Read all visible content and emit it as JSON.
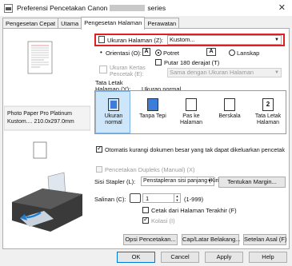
{
  "window": {
    "title_left": "Preferensi Pencetakan Canon",
    "title_right": "series",
    "close": "✕"
  },
  "tabs": [
    {
      "label": "Pengesetan Cepat"
    },
    {
      "label": "Utama"
    },
    {
      "label": "Pengesetan Halaman"
    },
    {
      "label": "Perawatan"
    }
  ],
  "preview": {
    "media_line1": "Photo Paper Pro Platinum",
    "media_line2": "Kustom.... 210.0x297.0mm"
  },
  "page_size": {
    "label": "Ukuran Halaman (Z):",
    "value": "Kustom..."
  },
  "orientation": {
    "label": "Orientasi (O):",
    "portrait": "Potret",
    "landscape": "Lanskap",
    "rotate180": "Putar 180 derajat (T)",
    "portrait_icon": "A",
    "landscape_icon": "A"
  },
  "paper_size": {
    "label_line1": "Ukuran Kertas",
    "label_line2": "Pencetak (E):",
    "value": "Sama dengan Ukuran Halaman"
  },
  "layout": {
    "label_line1": "Tata Letak",
    "label_line2": "Halaman (Y):",
    "current": "Ukuran normal",
    "items": [
      {
        "line1": "Ukuran normal",
        "line2": ""
      },
      {
        "line1": "Tanpa Tepi",
        "line2": ""
      },
      {
        "line1": "Pas ke",
        "line2": "Halaman"
      },
      {
        "line1": "Berskala",
        "line2": ""
      },
      {
        "line1": "Tata Letak",
        "line2": "Halaman"
      }
    ],
    "layout_num": "2"
  },
  "auto_reduce": {
    "label": "Otomatis kurangi dokumen besar yang tak dapat dikeluarkan pencetak"
  },
  "duplex": {
    "label": "Pencetakan Dupleks (Manual) (X)"
  },
  "stapling": {
    "label": "Sisi Stapler (L):",
    "value": "Penstapleran sisi panjang (Kiri)",
    "margin_button": "Tentukan Margin..."
  },
  "copies": {
    "label": "Salinan (C):",
    "value": "1",
    "range": "(1-999)",
    "last_page_first": "Cetak dari Halaman Terakhir (F)",
    "collate": "Kolasi (I)"
  },
  "panel_buttons": {
    "options": "Opsi Pencetakan...",
    "stamp": "Cap/Latar Belakang...",
    "defaults": "Setelan Asal (F)"
  },
  "dialog_buttons": {
    "ok": "OK",
    "cancel": "Cancel",
    "apply": "Apply",
    "help": "Help"
  },
  "colors": {
    "highlight_red": "#e02020",
    "selection_blue": "#3b7dd8"
  }
}
